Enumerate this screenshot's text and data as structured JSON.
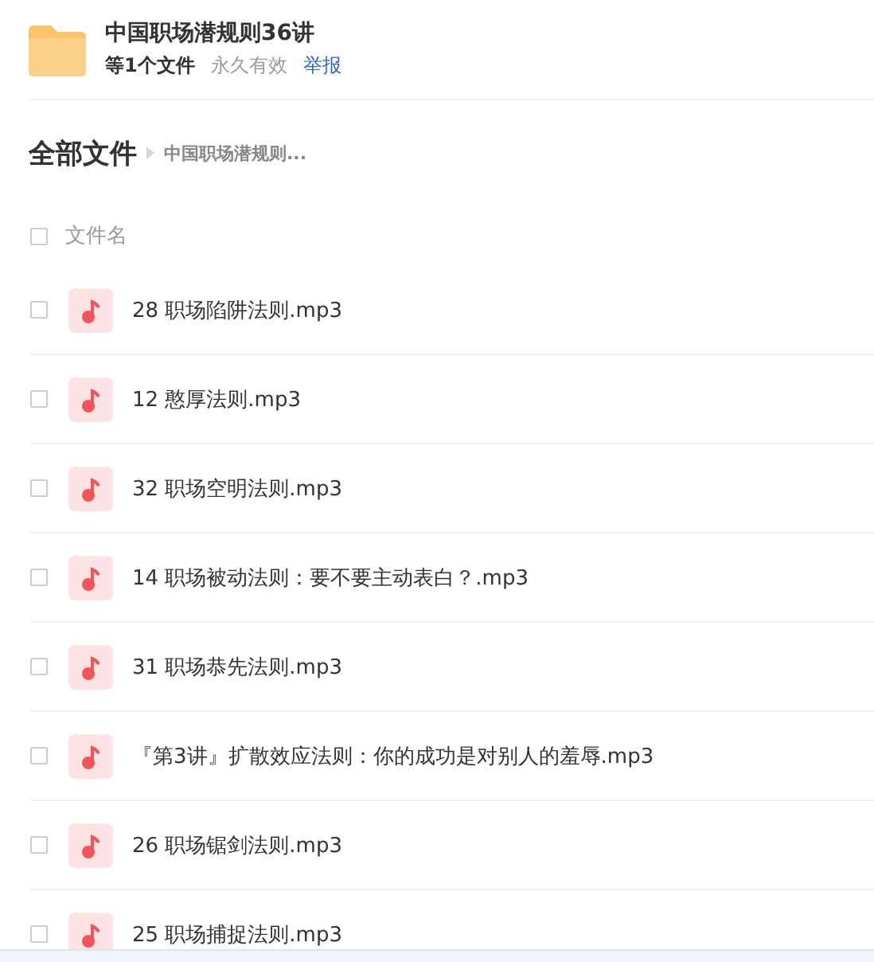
{
  "share": {
    "title": "中国职场潜规则36讲",
    "file_count": "等1个文件",
    "validity": "永久有效",
    "report_link": "举报"
  },
  "breadcrumb": {
    "root": "全部文件",
    "current": "中国职场潜规则..."
  },
  "table": {
    "header": {
      "label": "文件名",
      "checked": false
    },
    "rows": [
      {
        "name": "28 职场陷阱法则.mp3",
        "checked": false
      },
      {
        "name": "12 憨厚法则.mp3",
        "checked": false
      },
      {
        "name": "32 职场空明法则.mp3",
        "checked": false
      },
      {
        "name": "14 职场被动法则：要不要主动表白？.mp3",
        "checked": false
      },
      {
        "name": "31 职场恭先法则.mp3",
        "checked": false
      },
      {
        "name": "『第3讲』扩散效应法则：你的成功是对别人的羞辱.mp3",
        "checked": false
      },
      {
        "name": "26 职场锯剑法则.mp3",
        "checked": false
      },
      {
        "name": "25 职场捕捉法则.mp3",
        "checked": false
      }
    ]
  }
}
